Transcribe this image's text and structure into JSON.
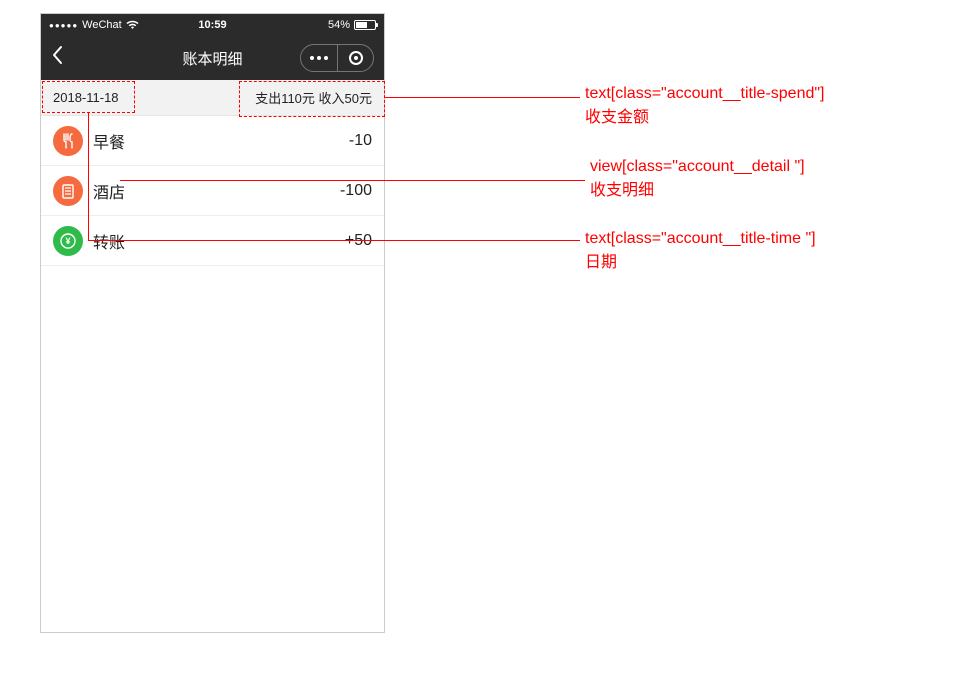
{
  "status": {
    "carrier": "WeChat",
    "time": "10:59",
    "battery_pct": "54%"
  },
  "nav": {
    "title": "账本明细"
  },
  "summary": {
    "date": "2018-11-18",
    "spend_income": "支出110元 收入50元"
  },
  "rows": [
    {
      "label": "早餐",
      "amount": "-10"
    },
    {
      "label": "酒店",
      "amount": "-100"
    },
    {
      "label": "转账",
      "amount": "+50"
    }
  ],
  "annotations": {
    "spend": {
      "selector": "text[class=\"account__title-spend\"]",
      "desc": "收支金额"
    },
    "detail": {
      "selector": "view[class=\"account__detail \"]",
      "desc": "收支明细"
    },
    "time": {
      "selector": "text[class=\"account__title-time \"]",
      "desc": "日期"
    }
  }
}
